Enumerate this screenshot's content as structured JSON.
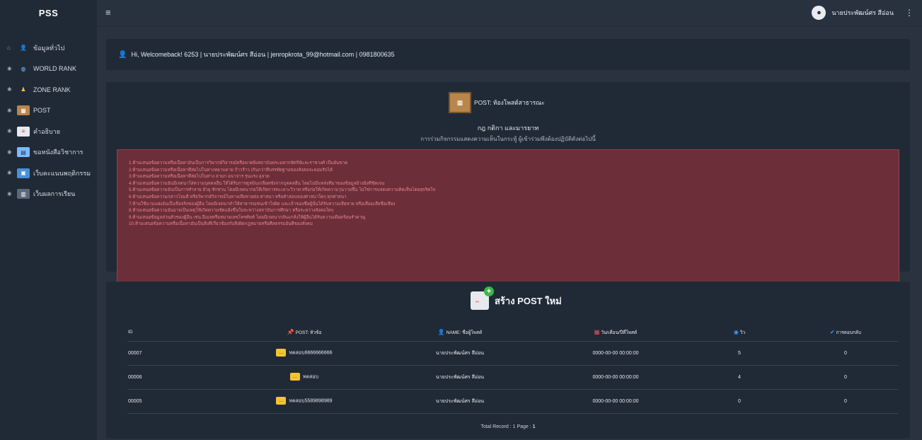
{
  "app": {
    "brand": "PSS"
  },
  "topbar": {
    "user_name": "นายประพัฒน์ศร สีอ่อน"
  },
  "sidebar": {
    "items": [
      {
        "label": "ข้อมูลทั่วไป",
        "icon": "user-icon"
      },
      {
        "label": "WORLD RANK",
        "icon": "globe-icon"
      },
      {
        "label": "ZONE RANK",
        "icon": "people-icon"
      },
      {
        "label": "POST",
        "icon": "corkboard-icon"
      },
      {
        "label": "คำอธิบาย",
        "icon": "document-icon"
      },
      {
        "label": "ขอหนังสือวิชาการ",
        "icon": "books-icon"
      },
      {
        "label": "เว็บคะแนนพฤติกรรม",
        "icon": "monitor-icon"
      },
      {
        "label": "เว็บผลการเรียน",
        "icon": "report-icon"
      }
    ]
  },
  "welcome": {
    "text": "Hi, Welcomeback! 6253 | นายประพัฒน์ศร สีอ่อน | jenropkrota_99@hotmail.com | 0981800635"
  },
  "rules": {
    "badge": "POST: ห้องโพสต์สาธารณะ",
    "title": "กฎ กติกา และมารยาท",
    "subtitle": "การร่วมกิจกรรมแสดงความเห็นในกระทู้ ผู้เข้าร่วมพึงต้องปฏิบัติดังต่อไปนี้",
    "items": [
      "1.ห้ามเสนอข้อความหรือเนื้อหาอันเป็นการวิพากษ์วิจารณ์หรือพาดพิงสถาบันพระมหากษัตริย์และราชวงศ์ เป็นอันขาด",
      "2.ห้ามเสนอข้อความหรือเนื้อหาที่ส่อไปในทางหยาบคาย ก้าวร้าว เกินกว่าที่บรรทัดฐานของสังคมจะยอมรับได้",
      "3.ห้ามเสนอข้อความหรือเนื้อหาที่ส่อไปในทาง ลามก อนาจาร รุนแรง อุจาด",
      "4.ห้ามเสนอข้อความอันมีเจตนาใส่ความบุคคลอื่น ให้ได้รับการดูหมิ่นเกลียดชังจากบุคคลอื่น โดยไม่มีแหล่งที่มาของข้อมูลอ้างอิงที่ชัดเจน",
      "5.ห้ามเสนอข้อความอันเป็นการทำลาย ยั่วยุ ชักชวน โดยมีเจตนาก่อให้เกิดการทะเลาะวิวาท หรือก่อให้เกิดความวุ่นวายขึ้น ไม่ใช่การแสดงความคิดเห็นโดยสุจริตใจ",
      "6.ห้ามเสนอข้อความกล่าวโจมตี หรือวิพากษ์วิจารณ์ในทางเสียหายต่อ ศาสนา หรือคำสอนของศาสนาใดๆ ทุกศาสนา",
      "7.ห้ามใช้นามแฝงอันเป็นชื่อจริงของผู้อื่น โดยมีเจตนาทำให้สาธารณชนเข้าใจผิด และเจ้าของชื่อผู้นั้นได้รับความเสียหาย หรือเสื่อมเสียชื่อเสียง",
      "8.ห้ามเสนอข้อความอันอาจเป็นเหตุให้เกิดความขัดแย้งขึ้นในระหว่างสถาบันการศึกษา หรือระหว่างสังคมใดๆ",
      "9.ห้ามเสนอข้อมูลส่วนตัวของผู้อื่น เช่น อีเมลหรือหมายเลขโทรศัพท์ โดยมีเจตนากลั่นแกล้งให้ผู้อื่นได้รับความเดือดร้อนรำคาญ",
      "10.ห้ามเสนอข้อความหรือเนื้อหาอันเป็นสิ่งที่เกี่ยวข้องกับสิ่งผิดกฎหมายหรือศีลธรรมอันดีของสังคม"
    ]
  },
  "posts": {
    "create_label": "สร้าง POST ใหม่",
    "headers": [
      "ID",
      "POST: หัวข้อ",
      "NAME: ชื่อผู้โพสต์",
      "วัน/เดือน/ปีที่โพสต์",
      "วิว",
      "การตอบกลับ"
    ],
    "rows": [
      {
        "id": "00007",
        "topic": "ทดสอบ6666666666",
        "name": "นายประพัฒน์ศร สีอ่อน",
        "date": "0000-00-00 00:00:00",
        "views": "5",
        "replies": "0"
      },
      {
        "id": "00006",
        "topic": "ทดสอบ",
        "name": "นายประพัฒน์ศร สีอ่อน",
        "date": "0000-00-00 00:00:00",
        "views": "4",
        "replies": "0"
      },
      {
        "id": "00005",
        "topic": "ทดสอบ5589898989",
        "name": "นายประพัฒน์ศร สีอ่อน",
        "date": "0000-00-00 00:00:00",
        "views": "0",
        "replies": "0"
      }
    ],
    "total_prefix": "Total Record : 1 Page : ",
    "total_page": "1"
  }
}
